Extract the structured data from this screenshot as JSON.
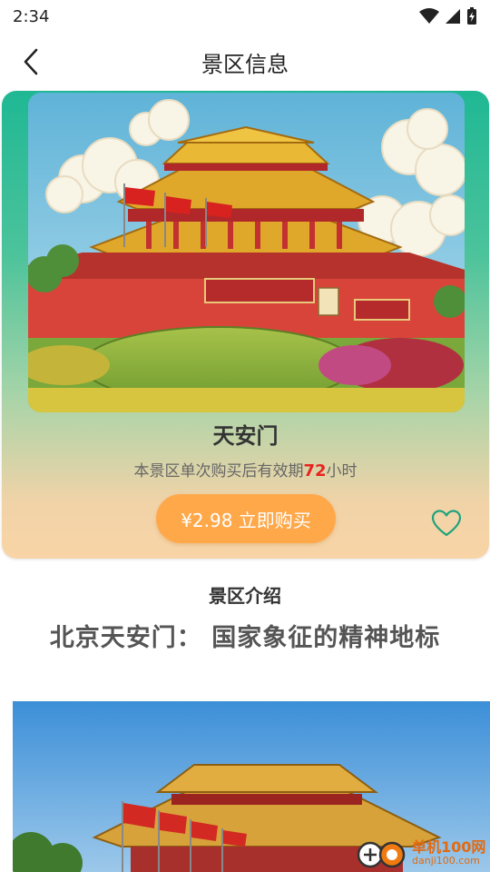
{
  "status": {
    "time": "2:34"
  },
  "header": {
    "title": "景区信息"
  },
  "spot": {
    "name": "天安门",
    "validity_prefix": "本景区单次购买后有效期",
    "validity_hours": "72",
    "validity_suffix": "小时",
    "buy_label": "¥2.98 立即购买"
  },
  "intro": {
    "section_label": "景区介绍",
    "title": "北京天安门： 国家象征的精神地标"
  },
  "watermark": {
    "name": "单机100网",
    "url": "danji100.com"
  },
  "colors": {
    "accent_green": "#1fb894",
    "buy_orange": "#ffa84a",
    "hours_red": "#e8231f"
  },
  "icons": {
    "back": "chevron-left-icon",
    "favorite": "heart-outline-icon"
  }
}
